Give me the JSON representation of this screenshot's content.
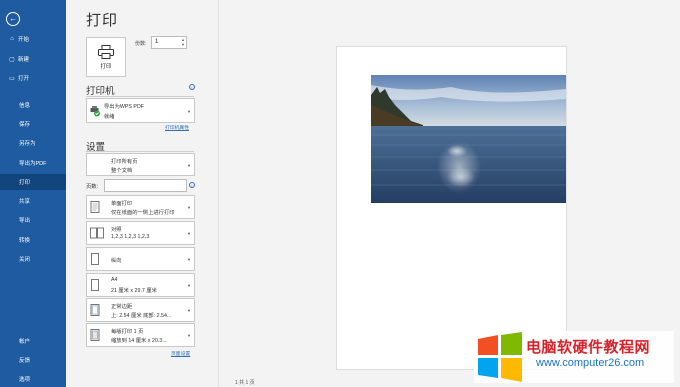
{
  "sidebar": {
    "items": [
      {
        "icon": "home-icon",
        "glyph": "⌂",
        "label": "开始"
      },
      {
        "icon": "new-doc-icon",
        "glyph": "▢",
        "label": "新建"
      },
      {
        "icon": "folder-icon",
        "glyph": "▭",
        "label": "打开"
      },
      {
        "label": "信息"
      },
      {
        "label": "保存"
      },
      {
        "label": "另存为"
      },
      {
        "label": "导出为PDF"
      },
      {
        "label": "打印"
      },
      {
        "label": "共享"
      },
      {
        "label": "导出"
      },
      {
        "label": "转换"
      },
      {
        "label": "关闭"
      },
      {
        "label": "帐户"
      },
      {
        "label": "反馈"
      },
      {
        "label": "选项"
      }
    ],
    "active_index": 7
  },
  "print": {
    "title": "打印",
    "button_label": "打印",
    "copies_label": "份数:",
    "copies_value": "1"
  },
  "printer": {
    "section_title": "打印机",
    "name": "导出为WPS PDF",
    "status": "就绪",
    "properties_link": "打印机属性"
  },
  "settings": {
    "section_title": "设置",
    "pages_label": "页数:",
    "pages_value": "",
    "page_setup_link": "页面设置",
    "options": [
      {
        "name": "print-range",
        "line1": "打印所有页",
        "line2": "整个文档"
      },
      {
        "name": "sides",
        "line1": "单面打印",
        "line2": "仅在纸面的一侧上进行打印"
      },
      {
        "name": "collation",
        "line1": "对照",
        "line2": "1,2,3     1,2,3     1,2,3"
      },
      {
        "name": "orientation",
        "line1": "纵向",
        "line2": ""
      },
      {
        "name": "paper-size",
        "line1": "A4",
        "line2": "21 厘米 x 29.7 厘米"
      },
      {
        "name": "margins",
        "line1": "正常边距",
        "line2": "上: 2.54 厘米 底部: 2.54..."
      },
      {
        "name": "pages-per-sheet",
        "line1": "每版打印 1 页",
        "line2": "缩放到 14 厘米 x 20.3..."
      }
    ]
  },
  "preview": {
    "pager_text": "1    共 1 页"
  },
  "watermark": {
    "title": "电脑软硬件教程网",
    "url": "www.computer26.com"
  },
  "colors": {
    "sidebar": "#1f5ba0",
    "sidebar_active": "#12447d",
    "link": "#2f6fb6"
  }
}
